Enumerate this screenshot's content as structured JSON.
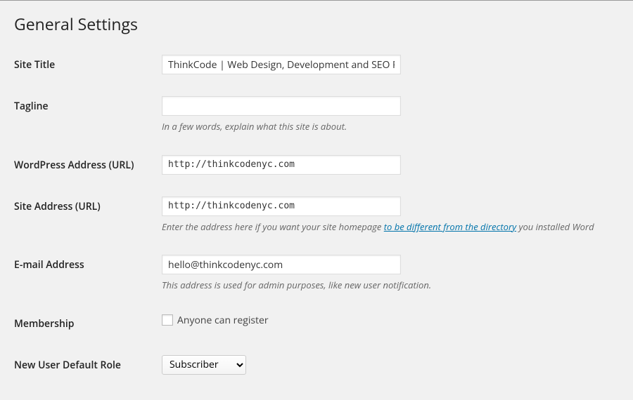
{
  "page_title": "General Settings",
  "fields": {
    "site_title": {
      "label": "Site Title",
      "value": "ThinkCode | Web Design, Development and SEO Firm"
    },
    "tagline": {
      "label": "Tagline",
      "value": "",
      "description": "In a few words, explain what this site is about."
    },
    "wp_address": {
      "label": "WordPress Address (URL)",
      "value": "http://thinkcodenyc.com"
    },
    "site_address": {
      "label": "Site Address (URL)",
      "value": "http://thinkcodenyc.com",
      "description_before": "Enter the address here if you want your site homepage ",
      "description_link": "to be different from the directory",
      "description_after": " you installed Word"
    },
    "email": {
      "label": "E-mail Address",
      "value": "hello@thinkcodenyc.com",
      "description": "This address is used for admin purposes, like new user notification."
    },
    "membership": {
      "label": "Membership",
      "checkbox_label": "Anyone can register"
    },
    "default_role": {
      "label": "New User Default Role",
      "selected": "Subscriber"
    }
  }
}
